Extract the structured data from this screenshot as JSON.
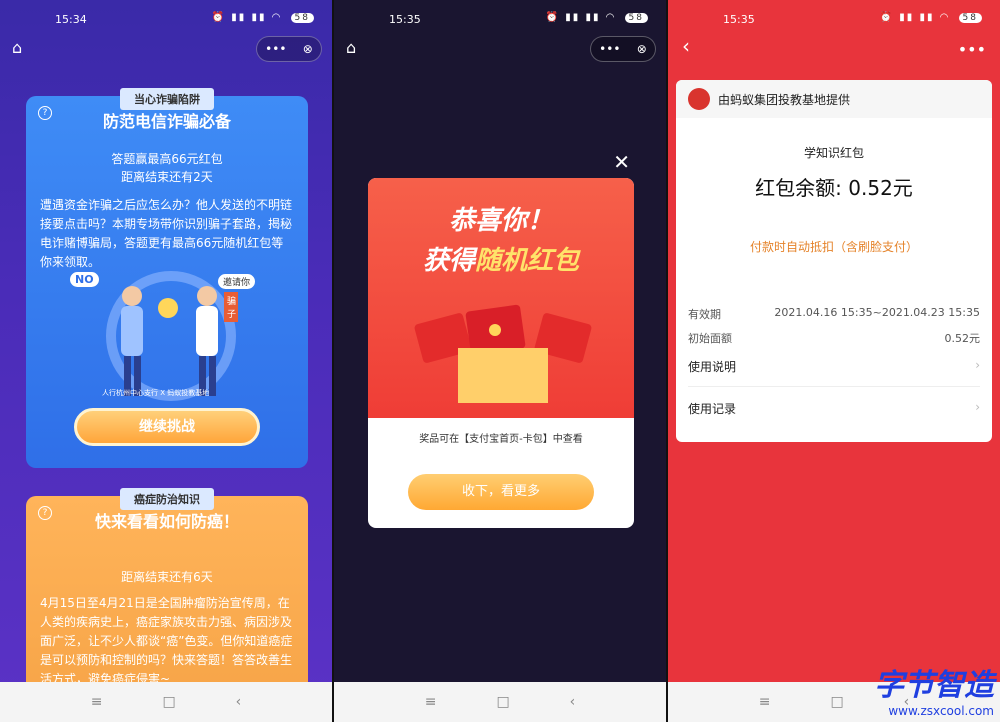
{
  "screen1": {
    "time": "15:34",
    "battery": "58",
    "card1": {
      "ribbon": "当心诈骗陷阱",
      "title": "防范电信诈骗必备",
      "line1": "答题赢最高66元红包",
      "line2": "距离结束还有2天",
      "para": "遭遇资金诈骗之后应怎么办？他人发送的不明链接要点击吗？本期专场带你识别骗子套路，揭秘电诈赌博骗局，答题更有最高66元随机红包等你来领取。",
      "no": "NO",
      "invite": "邀请你",
      "tag": "骗子",
      "logo_left": "人行杭州中心支行",
      "logo_sep": "X",
      "logo_right": "蚂蚁投教基地",
      "button": "继续挑战"
    },
    "card2": {
      "ribbon": "癌症防治知识",
      "title": "快来看看如何防癌！",
      "line1": "距离结束还有6天",
      "para": "4月15日至4月21日是全国肿瘤防治宣传周，在人类的疾病史上，癌症家族攻击力强、病因涉及面广泛，让不少人都谈“癌”色变。但你知道癌症是可以预防和控制的吗？快来答题！答答改善生活方式，避免癌症侵害~"
    }
  },
  "screen2": {
    "time": "15:35",
    "battery": "58",
    "popup": {
      "h1": "恭喜你！",
      "h2a": "获得",
      "h2b": "随机红包",
      "note": "奖品可在【支付宝首页-卡包】中查看",
      "button": "收下，看更多"
    }
  },
  "screen3": {
    "time": "15:35",
    "battery": "58",
    "provider": "由蚂蚁集团投教基地提供",
    "pack_name": "学知识红包",
    "balance": "红包余额: 0.52元",
    "auto_deduct": "付款时自动抵扣（含刷脸支付）",
    "validity_label": "有效期",
    "validity_value": "2021.04.16 15:35~2021.04.23 15:35",
    "initial_label": "初始面额",
    "initial_value": "0.52元",
    "usage_label": "使用说明",
    "records_label": "使用记录"
  },
  "watermark": {
    "line1": "字节智造",
    "line2": "www.zsxcool.com"
  },
  "colors": {
    "quiz_blue": "#3f8cf6",
    "cancer_orange": "#ffb45a",
    "alipay_red": "#e8343c",
    "deduct_orange": "#e5832a"
  }
}
